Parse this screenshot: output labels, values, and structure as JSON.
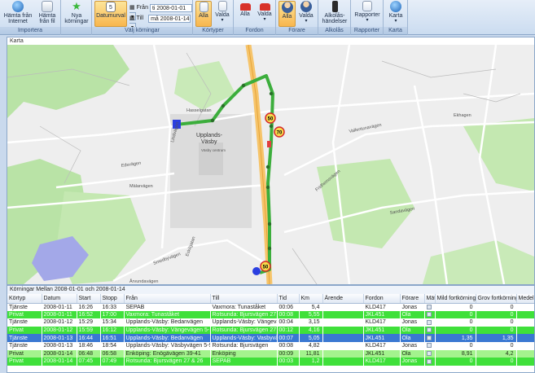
{
  "ribbon": {
    "importera": {
      "btn1": "Hämta från\nInternet",
      "btn1a": "Hämta från",
      "btn1b": "Internet",
      "btn2a": "Hämta",
      "btn2b": "från fil",
      "label": "Importera"
    },
    "nya": {
      "a": "Nya",
      "b": "körningar"
    },
    "valj": {
      "datumurval": "Datumurval",
      "fran_label": "Från",
      "fran_value": "ti 2008-01-01",
      "till_label": "Till",
      "till_value": "må 2008-01-14",
      "label": "Välj körningar"
    },
    "kortyper": {
      "alla": "Alla",
      "valda": "Valda",
      "label": "Körtyper"
    },
    "fordon": {
      "alla": "Alla",
      "valda": "Valda",
      "label": "Fordon"
    },
    "forare": {
      "alla": "Alla",
      "valda": "Valda",
      "label": "Förare"
    },
    "alkolas": {
      "a": "Alkolås-",
      "b": "händelser",
      "label": "Alkolås"
    },
    "rapporter": {
      "btn": "Rapporter",
      "label": "Rapporter"
    },
    "karta": {
      "btn": "Karta",
      "label": "Karta"
    }
  },
  "map": {
    "title": "Karta",
    "labels": {
      "haselgatan": "Hasselgatan",
      "centrum1": "Upplands-",
      "centrum2": "Väsby",
      "vasby_centrum": "Väsby centrum",
      "vallentuna": "Vallentunavägen",
      "fridhemsvagen": "Fridhemsvägen",
      "sandavagen": "Sandavägen",
      "malarvagen": "Mälarvägen",
      "edsvagen": "Edsvägen",
      "smedbyvagen": "Smedbyvägen",
      "eskilgata": "Eskilgatan",
      "ekhagen": "Ekhagen",
      "arvundavagen": "Årvundavägen",
      "lindvagen": "Lindvägen"
    },
    "speed_signs": [
      "50",
      "70",
      "50"
    ]
  },
  "grid": {
    "title": "Körningar Mellan 2008-01-01 och 2008-01-14",
    "columns": [
      "Körtyp",
      "Datum",
      "Start",
      "Stopp",
      "Från",
      "Till",
      "Tid",
      "Km",
      "Ärende",
      "Fordon",
      "Förare",
      "Mät",
      "Mild fortkörning",
      "Grov fortkörning",
      "Medel fo"
    ],
    "rows": [
      {
        "style": "r-white",
        "cells": [
          "Tjänste",
          "2008-01-11",
          "16:26",
          "16:33",
          "SEPAB",
          "Vaxmora: Tunaståket",
          "00:06",
          "5,4",
          "",
          "KLD417",
          "Jonas",
          "",
          "0",
          "0",
          ""
        ]
      },
      {
        "style": "r-green",
        "cells": [
          "Privat",
          "2008-01-11",
          "16:52",
          "17:00",
          "Vaxmora: Tunaståket",
          "Rotsunda: Bjursvägen 27 &",
          "00:08",
          "5,55",
          "",
          "JKL451",
          "Ola",
          "",
          "0",
          "0",
          ""
        ]
      },
      {
        "style": "r-white",
        "cells": [
          "Tjänste",
          "2008-01-12",
          "15:29",
          "15:34",
          "Upplands-Väsby: Bedanvägen",
          "Upplands-Väsby: Vängevåg",
          "00:04",
          "3,15",
          "",
          "KLD417",
          "Jonas",
          "",
          "0",
          "0",
          ""
        ]
      },
      {
        "style": "r-green",
        "cells": [
          "Privat",
          "2008-01-12",
          "15:59",
          "16:12",
          "Upplands-Väsby: Vängevägen 5-11",
          "Rotsunda: Bjursvägen 27 &",
          "00:12",
          "4,16",
          "",
          "JKL451",
          "Ola",
          "",
          "0",
          "0",
          ""
        ]
      },
      {
        "style": "r-sel",
        "cells": [
          "Tjänste",
          "2008-01-13",
          "16:44",
          "16:51",
          "Upplands-Väsby: Bedanvägen",
          "Upplands-Väsby: Vasbyvåg",
          "00:07",
          "5,05",
          "",
          "JKL451",
          "Ola",
          "",
          "1,35",
          "1,35",
          ""
        ]
      },
      {
        "style": "r-white",
        "cells": [
          "Tjänste",
          "2008-01-13",
          "18:46",
          "18:54",
          "Upplands-Väsby: Väsbyvägen 5-9 &",
          "Rotsunda: Bjursvägen",
          "00:08",
          "4,82",
          "",
          "KLD417",
          "Jonas",
          "",
          "0",
          "0",
          ""
        ]
      },
      {
        "style": "r-lgreen",
        "cells": [
          "Privat",
          "2008-01-14",
          "06:48",
          "06:58",
          "Enköping: Enögävägen 39-41",
          "Enköping",
          "00:09",
          "11,81",
          "",
          "JKL451",
          "Ola",
          "",
          "8,91",
          "4,2",
          ""
        ]
      },
      {
        "style": "r-green",
        "cells": [
          "Privat",
          "2008-01-14",
          "07:45",
          "07:49",
          "Rotsunda: Bjursvägen 27 & 26",
          "SEPAB",
          "00:03",
          "1,2",
          "",
          "KLD417",
          "Jonas",
          "",
          "0",
          "0",
          ""
        ]
      }
    ]
  },
  "colors": {
    "route": "#3cae3c",
    "ribbon_active": "#f8b64e",
    "row_green": "#3fe03a",
    "row_selected": "#3a78d2"
  }
}
